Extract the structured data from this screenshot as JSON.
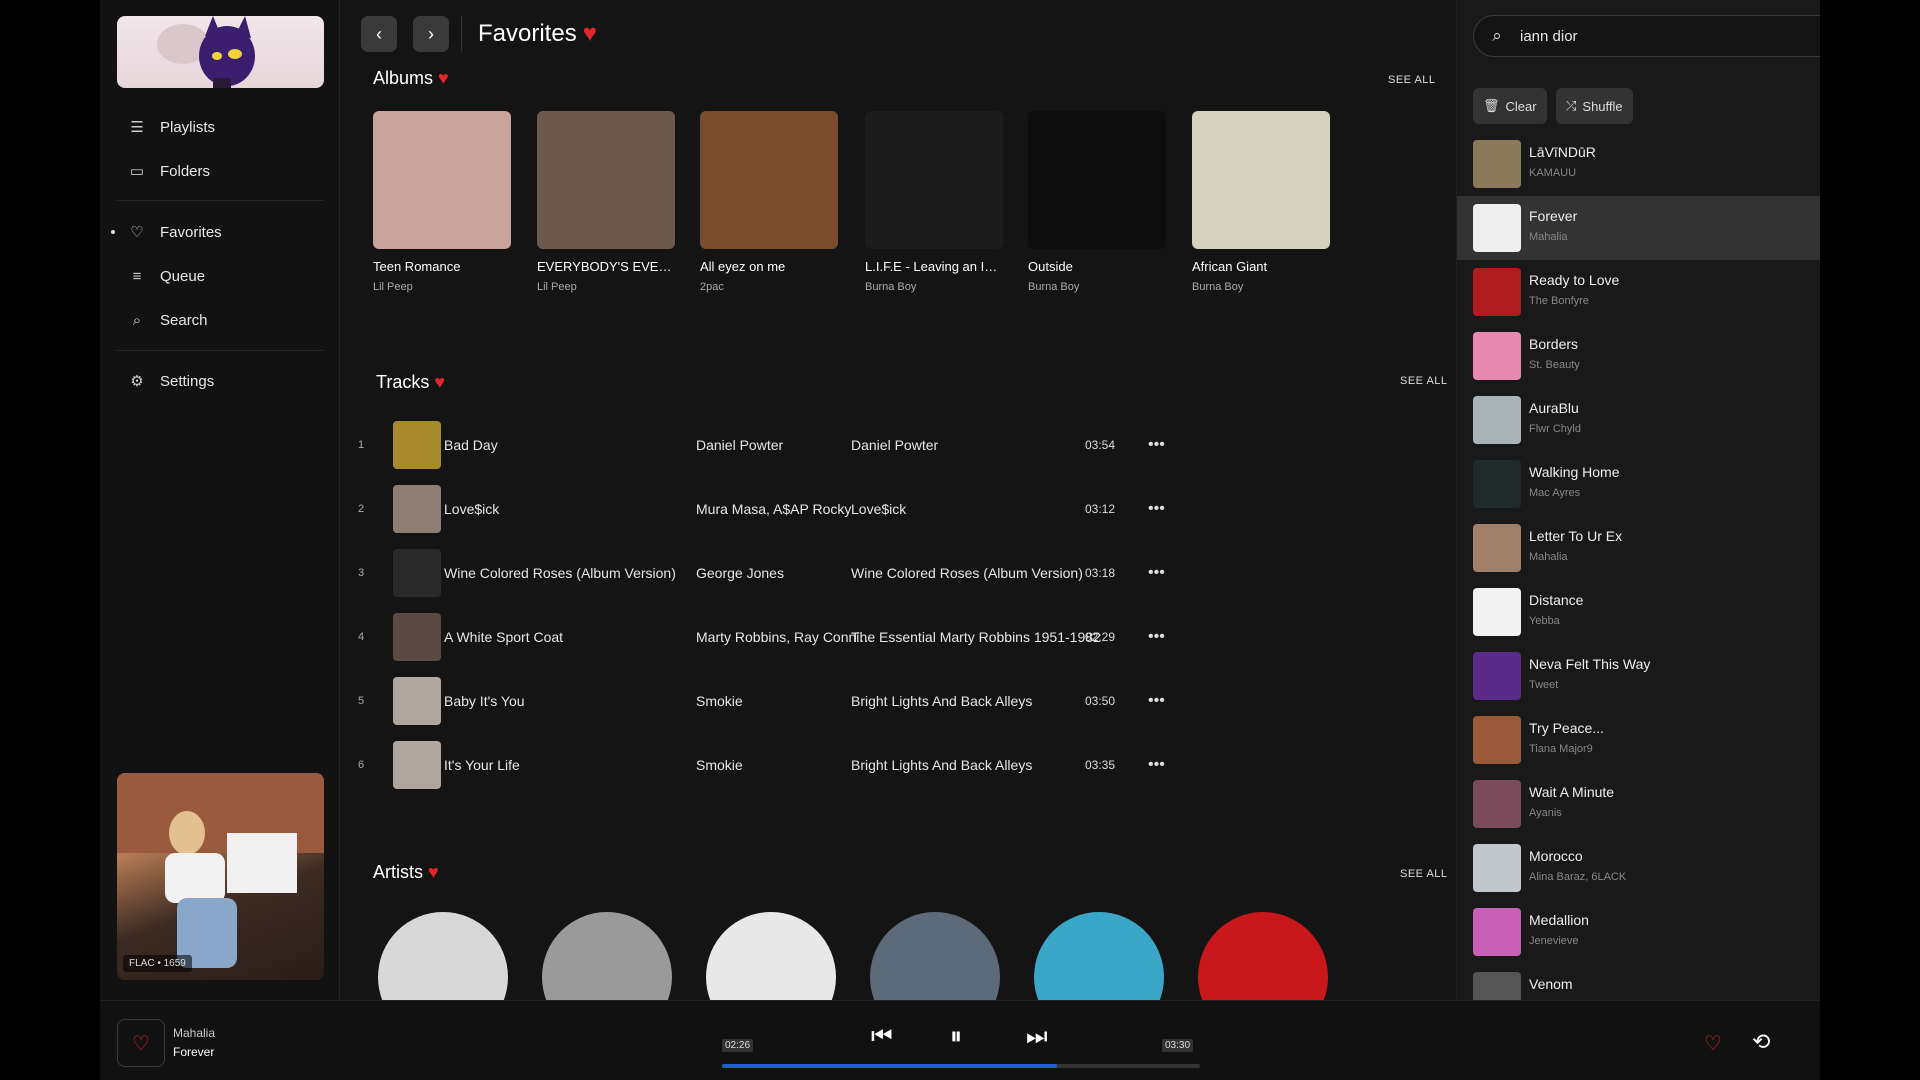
{
  "sidebar": {
    "nav": [
      {
        "label": "Playlists",
        "icon": "playlist-icon"
      },
      {
        "label": "Folders",
        "icon": "folder-icon"
      },
      {
        "label": "Favorites",
        "icon": "heart-icon"
      },
      {
        "label": "Queue",
        "icon": "queue-icon"
      },
      {
        "label": "Search",
        "icon": "search-icon"
      },
      {
        "label": "Settings",
        "icon": "gear-icon"
      }
    ],
    "now_playing_badge": "FLAC • 1659"
  },
  "main": {
    "title": "Favorites",
    "albums_title": "Albums",
    "tracks_title": "Tracks",
    "artists_title": "Artists",
    "see_all": "SEE ALL",
    "albums": [
      {
        "title": "Teen Romance",
        "artist": "Lil Peep",
        "color": "#c7a39a"
      },
      {
        "title": "EVERYBODY'S EVERYTHING",
        "artist": "Lil Peep",
        "color": "#6b5a4c"
      },
      {
        "title": "All eyez on me",
        "artist": "2pac",
        "color": "#7a4a2e"
      },
      {
        "title": "L.I.F.E - Leaving an Impact For Eternity",
        "artist": "Burna Boy",
        "color": "#1c1c1c"
      },
      {
        "title": "Outside",
        "artist": "Burna Boy",
        "color": "#0d0d0d"
      },
      {
        "title": "African Giant",
        "artist": "Burna Boy",
        "color": "#d7d2bd"
      }
    ],
    "tracks": [
      {
        "num": "1",
        "title": "Bad Day",
        "artist": "Daniel Powter",
        "album": "Daniel Powter",
        "duration": "03:54",
        "color": "#a88a2a"
      },
      {
        "num": "2",
        "title": "Love$ick",
        "artist": "Mura Masa, A$AP Rocky",
        "album": "Love$ick",
        "duration": "03:12",
        "color": "#8c7e74"
      },
      {
        "num": "3",
        "title": "Wine Colored Roses (Album Version)",
        "artist": "George Jones",
        "album": "Wine Colored Roses (Album Version)",
        "duration": "03:18",
        "color": "#2a2a2a"
      },
      {
        "num": "4",
        "title": "A White Sport Coat",
        "artist": "Marty Robbins, Ray Conniff and His Orchestra",
        "album": "The Essential Marty Robbins 1951-1982",
        "duration": "02:29",
        "color": "#5a4a44"
      },
      {
        "num": "5",
        "title": "Baby It's You",
        "artist": "Smokie",
        "album": "Bright Lights And Back Alleys",
        "duration": "03:50",
        "color": "#b0a6a0"
      },
      {
        "num": "6",
        "title": "It's Your Life",
        "artist": "Smokie",
        "album": "Bright Lights And Back Alleys",
        "duration": "03:35",
        "color": "#b0a6a0"
      }
    ],
    "artists": [
      "#d8d8d8",
      "#9a9a9a",
      "#e8e8e8",
      "#5c6a7a",
      "#3aa6c8",
      "#c8181c"
    ]
  },
  "queue": {
    "search_value": "iann dior",
    "clear_label": "Clear",
    "shuffle_label": "Shuffle",
    "items": [
      {
        "title": "LāVīNDūR",
        "artist": "KAMAUU",
        "color": "#8a7a5a"
      },
      {
        "title": "Forever",
        "artist": "Mahalia",
        "color": "#eeeeee"
      },
      {
        "title": "Ready to Love",
        "artist": "The Bonfyre",
        "color": "#b01c1c"
      },
      {
        "title": "Borders",
        "artist": "St. Beauty",
        "color": "#e88ab0"
      },
      {
        "title": "AuraBlu",
        "artist": "Flwr Chyld",
        "color": "#a8b4b8"
      },
      {
        "title": "Walking Home",
        "artist": "Mac Ayres",
        "color": "#1e2a2a"
      },
      {
        "title": "Letter To Ur Ex",
        "artist": "Mahalia",
        "color": "#a08068"
      },
      {
        "title": "Distance",
        "artist": "Yebba",
        "color": "#f2f2f2"
      },
      {
        "title": "Neva Felt This Way",
        "artist": "Tweet",
        "color": "#5a2a8a"
      },
      {
        "title": "Try Peace...",
        "artist": "Tiana Major9",
        "color": "#9a5a3a"
      },
      {
        "title": "Wait A Minute",
        "artist": "Ayanis",
        "color": "#7a4a5a"
      },
      {
        "title": "Morocco",
        "artist": "Alina Baraz, 6LACK",
        "color": "#c0c8cc"
      },
      {
        "title": "Medallion",
        "artist": "Jenevieve",
        "color": "#c860b8"
      },
      {
        "title": "Venom",
        "artist": "",
        "color": "#555555"
      }
    ]
  },
  "player": {
    "artist": "Mahalia",
    "title": "Forever",
    "current_time": "02:26",
    "total_time": "03:30",
    "progress_fraction": 0.7
  }
}
